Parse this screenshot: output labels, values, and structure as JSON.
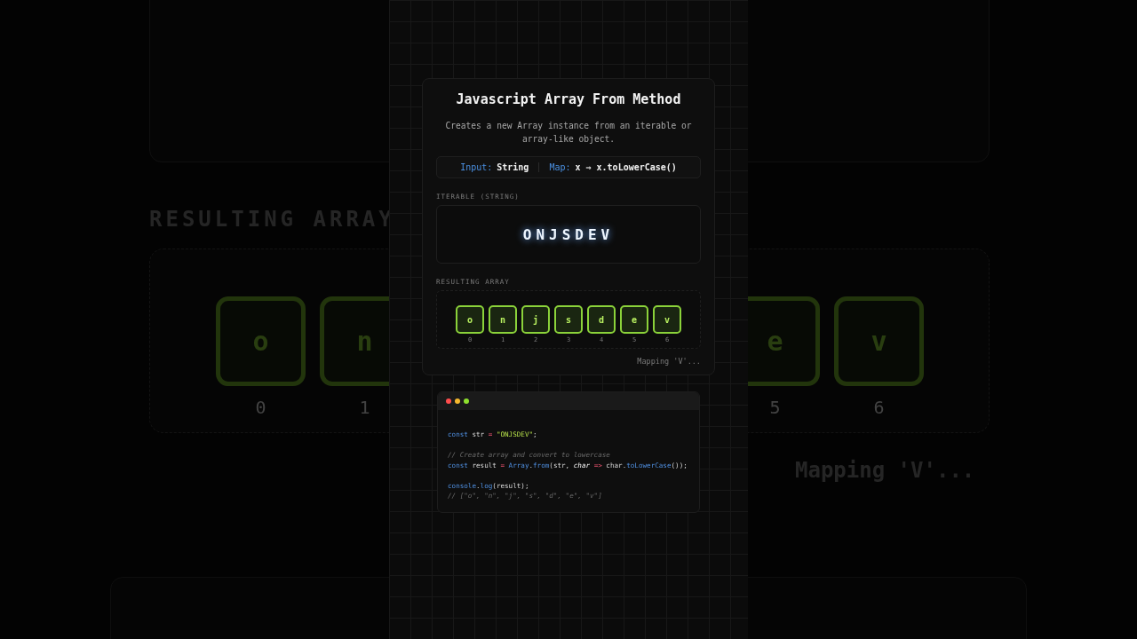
{
  "backdrop": {
    "heading": "RESULTING ARRAY",
    "left_cells": [
      {
        "char": "o",
        "index": "0"
      },
      {
        "char": "n",
        "index": "1"
      }
    ],
    "right_cells": [
      {
        "char": "e",
        "index": "5"
      },
      {
        "char": "v",
        "index": "6"
      }
    ],
    "status": "Mapping 'V'..."
  },
  "card": {
    "title": "Javascript Array From Method",
    "description": "Creates a new Array instance from an iterable or array-like object.",
    "info": [
      {
        "label": "Input:",
        "value": "String"
      },
      {
        "label": "Map:",
        "value": "x ⇒ x.toLowerCase()"
      }
    ],
    "iterable_label": "ITERABLE (STRING)",
    "iterable": "ONJSDEV",
    "result_label": "RESULTING ARRAY",
    "cells": [
      {
        "char": "o",
        "index": "0"
      },
      {
        "char": "n",
        "index": "1"
      },
      {
        "char": "j",
        "index": "2"
      },
      {
        "char": "s",
        "index": "3"
      },
      {
        "char": "d",
        "index": "4"
      },
      {
        "char": "e",
        "index": "5"
      },
      {
        "char": "v",
        "index": "6"
      }
    ],
    "status": "Mapping 'V'..."
  },
  "code": {
    "blocks": [
      {
        "lines": [
          {
            "tokens": [
              {
                "kind": "keyword",
                "text": "const"
              },
              {
                "kind": "plain",
                "text": " str"
              },
              {
                "kind": "op",
                "text": " = "
              },
              {
                "kind": "string",
                "text": "\"ONJSDEV\""
              },
              {
                "kind": "plain",
                "text": ";"
              }
            ]
          }
        ]
      },
      {
        "lines": [
          {
            "tokens": [
              {
                "kind": "comment",
                "text": "// Create array and convert to lowercase"
              }
            ]
          },
          {
            "tokens": [
              {
                "kind": "keyword",
                "text": "const"
              },
              {
                "kind": "plain",
                "text": " result"
              },
              {
                "kind": "op",
                "text": " = "
              },
              {
                "kind": "fn",
                "text": "Array"
              },
              {
                "kind": "plain",
                "text": "."
              },
              {
                "kind": "fn",
                "text": "from"
              },
              {
                "kind": "plain",
                "text": "(str, "
              },
              {
                "kind": "param",
                "text": "char"
              },
              {
                "kind": "op",
                "text": " => "
              },
              {
                "kind": "plain",
                "text": "char."
              },
              {
                "kind": "fn",
                "text": "toLowerCase"
              },
              {
                "kind": "plain",
                "text": "());"
              }
            ]
          }
        ]
      },
      {
        "lines": [
          {
            "tokens": [
              {
                "kind": "fn",
                "text": "console"
              },
              {
                "kind": "plain",
                "text": "."
              },
              {
                "kind": "fn",
                "text": "log"
              },
              {
                "kind": "plain",
                "text": "(result);"
              }
            ]
          },
          {
            "tokens": [
              {
                "kind": "comment",
                "text": "// [\"o\", \"n\", \"j\", \"s\", \"d\", \"e\", \"v\"]"
              }
            ]
          }
        ]
      }
    ]
  }
}
